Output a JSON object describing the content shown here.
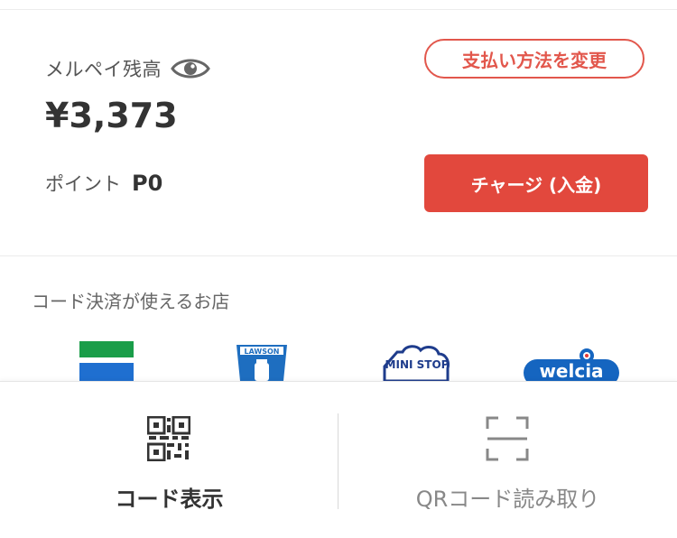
{
  "balance": {
    "label": "メルペイ残高",
    "amount": "¥3,373",
    "change_payment_label": "支払い方法を変更",
    "point_label": "ポイント",
    "point_value": "P0",
    "charge_label": "チャージ (入金)"
  },
  "stores": {
    "title": "コード決済が使えるお店",
    "logos": [
      {
        "name": "familymart-logo"
      },
      {
        "name": "lawson-logo",
        "text": "LAWSON"
      },
      {
        "name": "ministop-logo",
        "text": "MINI STOP"
      },
      {
        "name": "welcia-logo",
        "text": "welcia"
      }
    ]
  },
  "bottom_nav": {
    "show_code_label": "コード表示",
    "qr_read_label": "QRコード読み取り"
  },
  "colors": {
    "accent": "#e2483d",
    "text": "#333333",
    "muted": "#888888"
  }
}
